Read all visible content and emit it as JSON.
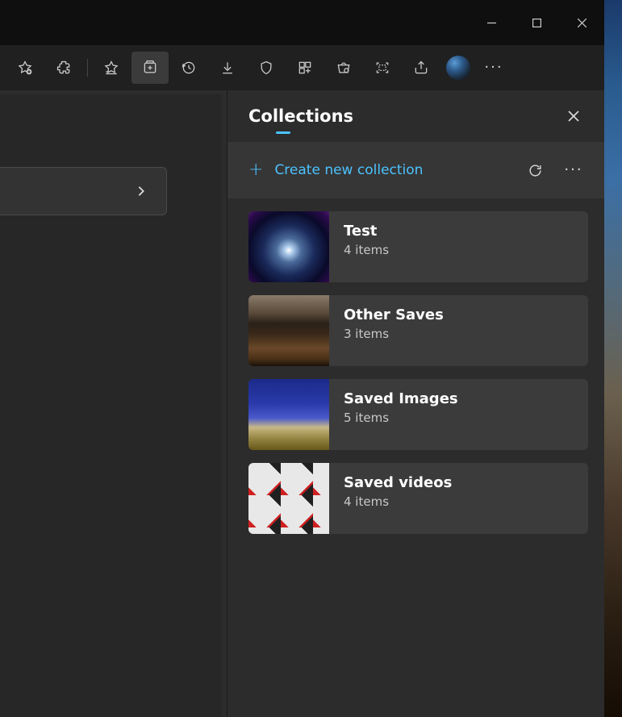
{
  "panel": {
    "title": "Collections",
    "create_label": "Create new collection"
  },
  "collections": [
    {
      "name": "Test",
      "count": "4 items"
    },
    {
      "name": "Other Saves",
      "count": "3 items"
    },
    {
      "name": "Saved Images",
      "count": "5 items"
    },
    {
      "name": "Saved videos",
      "count": "4 items"
    }
  ]
}
